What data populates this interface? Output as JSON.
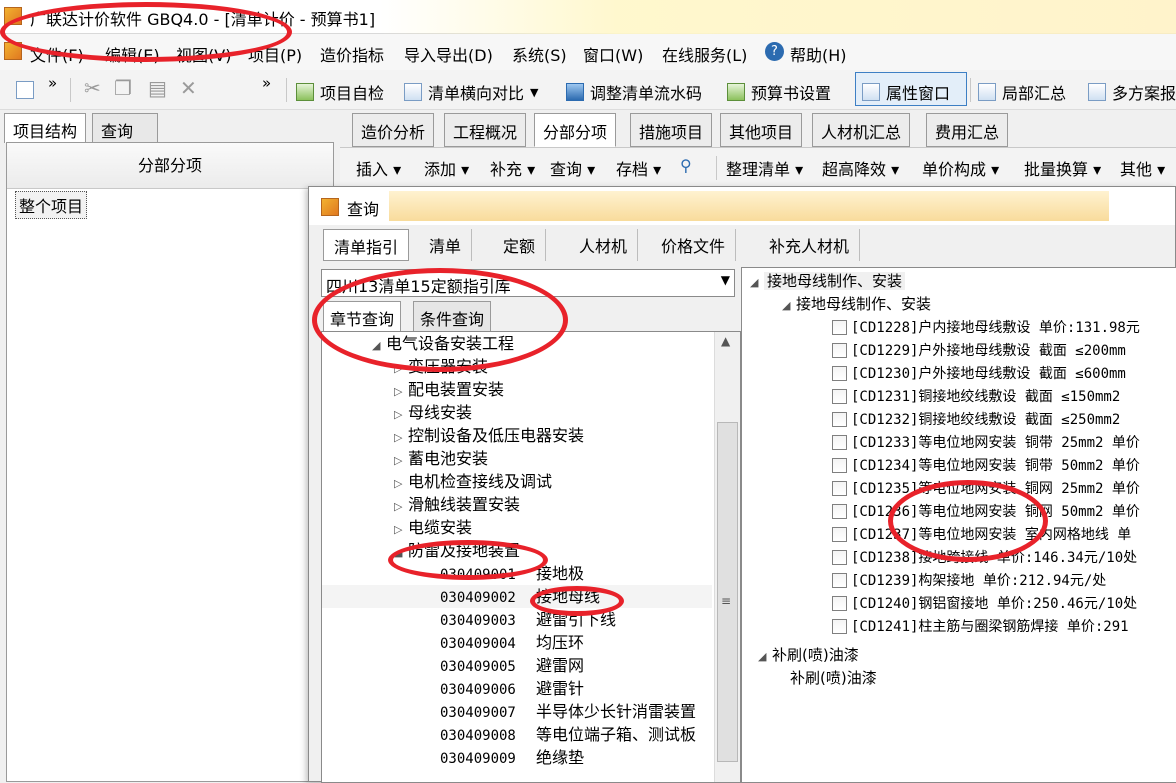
{
  "window": {
    "title": "广联达计价软件 GBQ4.0 - [清单计价 - 预算书1]"
  },
  "menu": [
    "文件(F)",
    "编辑(E)",
    "视图(V)",
    "项目(P)",
    "造价指标",
    "导入导出(D)",
    "系统(S)",
    "窗口(W)",
    "在线服务(L)",
    "帮助(H)"
  ],
  "toolbar": {
    "items": [
      "项目自检",
      "清单横向对比",
      "调整清单流水码",
      "预算书设置",
      "属性窗口",
      "局部汇总",
      "多方案报"
    ],
    "overflow": "»"
  },
  "left": {
    "tabs": [
      "项目结构",
      "查询"
    ],
    "header": "分部分项",
    "root": "整个项目"
  },
  "main_tabs": [
    "造价分析",
    "工程概况",
    "分部分项",
    "措施项目",
    "其他项目",
    "人材机汇总",
    "费用汇总"
  ],
  "toolbar2": [
    "插入",
    "添加",
    "补充",
    "查询",
    "存档",
    "整理清单",
    "超高降效",
    "单价构成",
    "批量换算",
    "其他"
  ],
  "dialog": {
    "title": "查询",
    "tabs": [
      "清单指引",
      "清单",
      "定额",
      "人材机",
      "价格文件",
      "补充人材机"
    ],
    "library": "四川13清单15定额指引库",
    "subtabs": [
      "章节查询",
      "条件查询"
    ],
    "tree": {
      "root": "电气设备安装工程",
      "children": [
        "变压器安装",
        "配电装置安装",
        "母线安装",
        "控制设备及低压电器安装",
        "蓄电池安装",
        "电机检查接线及调试",
        "滑触线装置安装",
        "电缆安装"
      ],
      "expanded": "防雷及接地装置",
      "items": [
        {
          "code": "030409001",
          "name": "接地极"
        },
        {
          "code": "030409002",
          "name": "接地母线"
        },
        {
          "code": "030409003",
          "name": "避雷引下线"
        },
        {
          "code": "030409004",
          "name": "均压环"
        },
        {
          "code": "030409005",
          "name": "避雷网"
        },
        {
          "code": "030409006",
          "name": "避雷针"
        },
        {
          "code": "030409007",
          "name": "半导体少长针消雷装置"
        },
        {
          "code": "030409008",
          "name": "等电位端子箱、测试板"
        },
        {
          "code": "030409009",
          "name": "绝缘垫"
        }
      ]
    },
    "quota": {
      "group": "接地母线制作、安装",
      "subgroup": "接地母线制作、安装",
      "rows": [
        "[CD1228]户内接地母线敷设 单价:131.98元",
        "[CD1229]户外接地母线敷设 截面 ≤200mm",
        "[CD1230]户外接地母线敷设 截面 ≤600mm",
        "[CD1231]铜接地绞线敷设 截面 ≤150mm2",
        "[CD1232]铜接地绞线敷设 截面 ≤250mm2",
        "[CD1233]等电位地网安装 铜带 25mm2 单价",
        "[CD1234]等电位地网安装 铜带 50mm2 单价",
        "[CD1235]等电位地网安装 铜网 25mm2 单价",
        "[CD1236]等电位地网安装 铜网 50mm2 单价",
        "[CD1237]等电位地网安装 室内网格地线 单",
        "[CD1238]接地跨接线 单价:146.34元/10处",
        "[CD1239]构架接地 单价:212.94元/处",
        "[CD1240]钢铝窗接地 单价:250.46元/10处",
        "[CD1241]柱主筋与圈梁钢筋焊接 单价:291"
      ],
      "group2": "补刷(喷)油漆",
      "group2_child": "补刷(喷)油漆"
    }
  }
}
